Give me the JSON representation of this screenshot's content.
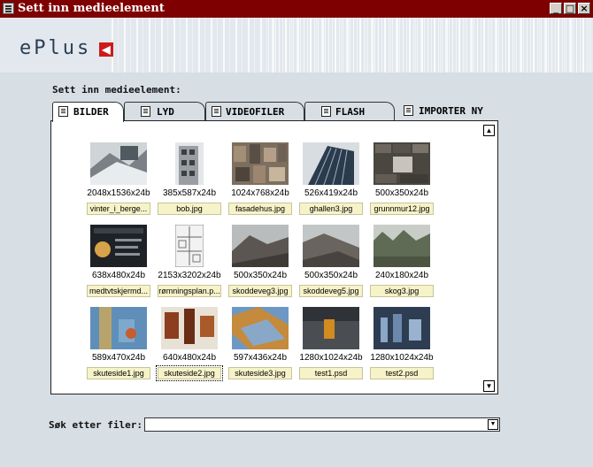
{
  "window": {
    "title": "Sett inn medieelement",
    "minimize": "_",
    "maximize": "□",
    "close": "×"
  },
  "header": {
    "logo": "ePlus",
    "logo_icon": "exit-icon"
  },
  "dialog": {
    "label": "Sett inn medieelement:"
  },
  "tabs": [
    {
      "label": "BILDER",
      "icon": "image-icon",
      "active": true
    },
    {
      "label": "LYD",
      "icon": "sound-icon",
      "active": false
    },
    {
      "label": "VIDEOFILER",
      "icon": "film-icon",
      "active": false
    },
    {
      "label": "FLASH",
      "icon": "flash-icon",
      "active": false
    },
    {
      "label": "IMPORTER NY",
      "icon": "import-icon",
      "active": false
    }
  ],
  "files": [
    {
      "dims": "2048x1536x24b",
      "name": "vinter_i_berge..."
    },
    {
      "dims": "385x587x24b",
      "name": "bob.jpg"
    },
    {
      "dims": "1024x768x24b",
      "name": "fasadehus.jpg"
    },
    {
      "dims": "526x419x24b",
      "name": "ghallen3.jpg"
    },
    {
      "dims": "500x350x24b",
      "name": "grunnmur12.jpg"
    },
    {
      "dims": "638x480x24b",
      "name": "medtvtskjermd..."
    },
    {
      "dims": "2153x3202x24b",
      "name": "rømningsplan.p..."
    },
    {
      "dims": "500x350x24b",
      "name": "skoddeveg3.jpg"
    },
    {
      "dims": "500x350x24b",
      "name": "skoddeveg5.jpg"
    },
    {
      "dims": "240x180x24b",
      "name": "skog3.jpg"
    },
    {
      "dims": "589x470x24b",
      "name": "skuteside1.jpg"
    },
    {
      "dims": "640x480x24b",
      "name": "skuteside2.jpg",
      "selected": true
    },
    {
      "dims": "597x436x24b",
      "name": "skuteside3.jpg"
    },
    {
      "dims": "1280x1024x24b",
      "name": "test1.psd"
    },
    {
      "dims": "1280x1024x24b",
      "name": "test2.psd"
    }
  ],
  "scroll": {
    "up": "▲",
    "down": "▼"
  },
  "search": {
    "label": "Søk etter filer:",
    "value": "",
    "dropdown": "▼"
  },
  "colors": {
    "titlebar": "#7e0000",
    "background": "#d7dee4",
    "filename_bg": "#f6f3c9"
  }
}
